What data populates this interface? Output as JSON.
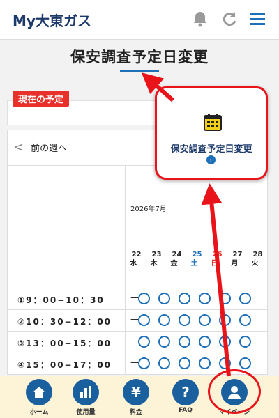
{
  "header": {
    "app_title": "My大東ガス",
    "icons": [
      "bell-icon",
      "refresh-icon",
      "menu-icon"
    ]
  },
  "page": {
    "title": "保安調査予定日変更"
  },
  "current": {
    "badge": "現在の予定"
  },
  "calendar": {
    "prev_week": "前の週へ",
    "month": "2026年7月",
    "days": [
      {
        "date": "22",
        "weekday": "水",
        "type": "normal"
      },
      {
        "date": "23",
        "weekday": "木",
        "type": "normal"
      },
      {
        "date": "24",
        "weekday": "金",
        "type": "normal"
      },
      {
        "date": "25",
        "weekday": "土",
        "type": "sat"
      },
      {
        "date": "26",
        "weekday": "日",
        "type": "sun"
      },
      {
        "date": "27",
        "weekday": "月",
        "type": "normal"
      },
      {
        "date": "28",
        "weekday": "火",
        "type": "normal"
      }
    ],
    "slots": [
      {
        "label": "①9：00−10：30",
        "first": "—",
        "mark": "○"
      },
      {
        "label": "②10：30−12：00",
        "first": "—",
        "mark": "○"
      },
      {
        "label": "③13：00−15：00",
        "first": "—",
        "mark": "○"
      },
      {
        "label": "④15：00−17：00",
        "first": "—",
        "mark": "○"
      }
    ]
  },
  "nav": [
    {
      "label": "ホーム",
      "icon": "home-icon"
    },
    {
      "label": "使用量",
      "icon": "bar-chart-icon"
    },
    {
      "label": "料金",
      "icon": "yen-icon",
      "glyph": "¥"
    },
    {
      "label": "FAQ",
      "icon": "question-icon",
      "glyph": "?"
    },
    {
      "label": "マイページ",
      "icon": "user-icon"
    }
  ],
  "callout": {
    "label": "保安調査予定日変更",
    "icon": "calendar-icon",
    "go_icon": "chevron-right-icon",
    "go_glyph": "›"
  },
  "colors": {
    "brand": "#1d3a6b",
    "accent": "#1d6fb8",
    "alert": "#e8312a",
    "nav_bg": "#fdf3d6"
  }
}
